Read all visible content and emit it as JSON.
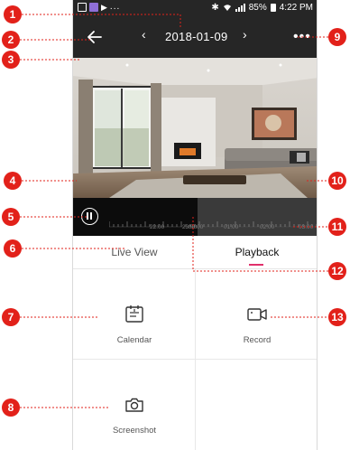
{
  "status_bar": {
    "play_icon": "▶",
    "dots": "...",
    "bluetooth": "✱",
    "battery_percent": "85%",
    "time": "4:22 PM"
  },
  "top_bar": {
    "prev_arrow": "‹",
    "date": "2018-01-09",
    "next_arrow": "›",
    "more": "•••"
  },
  "timeline": {
    "tick_labels": [
      "22:00",
      "23:00",
      "00:00",
      "01:00",
      "02:00",
      "03:00"
    ]
  },
  "tabs": {
    "live_view": "Live View",
    "playback": "Playback",
    "active_tab": "Playback",
    "accent_color": "#e0306b"
  },
  "actions": {
    "calendar": "Calendar",
    "record": "Record",
    "screenshot": "Screenshot"
  },
  "callouts": [
    "1",
    "2",
    "3",
    "4",
    "5",
    "6",
    "7",
    "8",
    "9",
    "10",
    "11",
    "12",
    "13"
  ],
  "colors": {
    "callout": "#e2211a",
    "header": "#262626",
    "timeline": "#0c0c0c"
  }
}
